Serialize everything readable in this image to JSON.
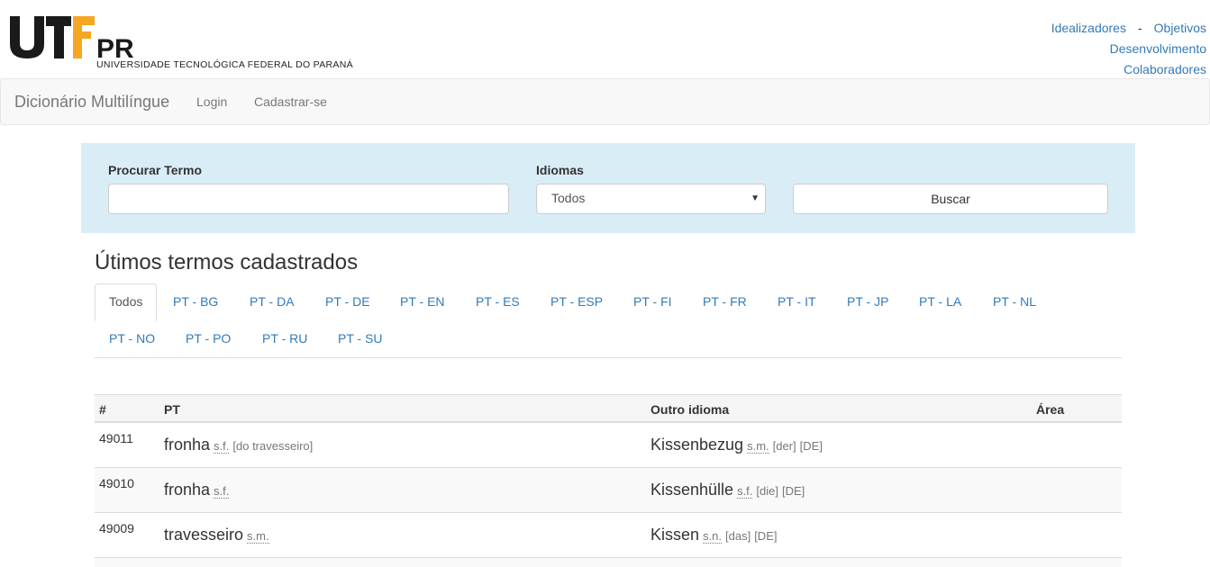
{
  "header": {
    "logo_text": "UTFPR",
    "logo_subtitle": "UNIVERSIDADE TECNOLÓGICA FEDERAL DO PARANÁ",
    "links": {
      "idealizadores": "Idealizadores",
      "separator": "-",
      "objetivos": "Objetivos",
      "desenvolvimento": "Desenvolvimento",
      "colaboradores": "Colaboradores"
    }
  },
  "navbar": {
    "brand": "Dicionário Multilíngue",
    "login": "Login",
    "signup": "Cadastrar-se"
  },
  "search": {
    "term_label": "Procurar Termo",
    "term_value": "",
    "lang_label": "Idiomas",
    "lang_selected": "Todos",
    "button": "Buscar"
  },
  "section_title": "Útimos termos cadastrados",
  "tabs": [
    "Todos",
    "PT - BG",
    "PT - DA",
    "PT - DE",
    "PT - EN",
    "PT - ES",
    "PT - ESP",
    "PT - FI",
    "PT - FR",
    "PT - IT",
    "PT - JP",
    "PT - LA",
    "PT - NL",
    "PT - NO",
    "PT - PO",
    "PT - RU",
    "PT - SU"
  ],
  "table": {
    "headers": {
      "id": "#",
      "pt": "PT",
      "other": "Outro idioma",
      "area": "Área"
    },
    "rows": [
      {
        "id": "49011",
        "pt_term": "fronha",
        "pt_class": "s.f.",
        "pt_extra": "[do travesseiro]",
        "other_term": "Kissenbezug",
        "other_class": "s.m.",
        "other_article": "[der]",
        "other_lang": "[DE]",
        "area": ""
      },
      {
        "id": "49010",
        "pt_term": "fronha",
        "pt_class": "s.f.",
        "pt_extra": "",
        "other_term": "Kissenhülle",
        "other_class": "s.f.",
        "other_article": "[die]",
        "other_lang": "[DE]",
        "area": ""
      },
      {
        "id": "49009",
        "pt_term": "travesseiro",
        "pt_class": "s.m.",
        "pt_extra": "",
        "other_term": "Kissen",
        "other_class": "s.n.",
        "other_article": "[das]",
        "other_lang": "[DE]",
        "area": ""
      }
    ]
  },
  "colors": {
    "link": "#337ab7",
    "panel_bg": "#d9edf7",
    "navbar_bg": "#f8f8f8",
    "logo_orange": "#f5a623"
  }
}
